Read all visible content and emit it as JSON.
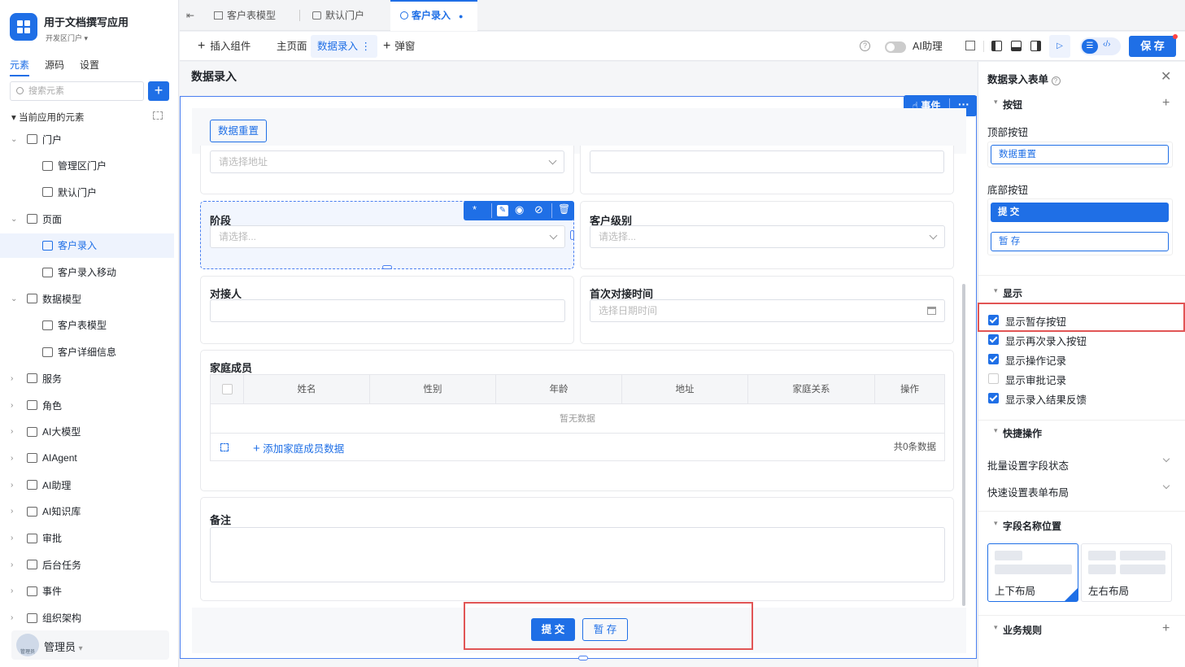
{
  "app": {
    "title": "用于文档撰写应用",
    "subtitle": "开发区门户"
  },
  "sidebar": {
    "tabs": [
      "元素",
      "源码",
      "设置"
    ],
    "search_placeholder": "搜索元素",
    "group_title": "当前应用的元素",
    "items": [
      {
        "label": "门户",
        "level": 1,
        "expanded": true
      },
      {
        "label": "管理区门户",
        "level": 2
      },
      {
        "label": "默认门户",
        "level": 2
      },
      {
        "label": "页面",
        "level": 1,
        "expanded": true
      },
      {
        "label": "客户录入",
        "level": 2,
        "active": true
      },
      {
        "label": "客户录入移动",
        "level": 2
      },
      {
        "label": "数据模型",
        "level": 1,
        "expanded": true
      },
      {
        "label": "客户表模型",
        "level": 2
      },
      {
        "label": "客户详细信息",
        "level": 2
      },
      {
        "label": "服务",
        "level": 1
      },
      {
        "label": "角色",
        "level": 1
      },
      {
        "label": "AI大模型",
        "level": 1
      },
      {
        "label": "AIAgent",
        "level": 1
      },
      {
        "label": "AI助理",
        "level": 1
      },
      {
        "label": "AI知识库",
        "level": 1
      },
      {
        "label": "审批",
        "level": 1
      },
      {
        "label": "后台任务",
        "level": 1
      },
      {
        "label": "事件",
        "level": 1
      },
      {
        "label": "组织架构",
        "level": 1
      }
    ],
    "user": {
      "name": "管理员",
      "avatar_text": "管理员"
    }
  },
  "tabs": [
    {
      "label": "客户表模型"
    },
    {
      "label": "默认门户"
    },
    {
      "label": "客户录入",
      "active": true
    }
  ],
  "toolbar": {
    "insert": "插入组件",
    "main_page": "主页面",
    "data_entry": "数据录入",
    "popup": "弹窗",
    "ai_assistant": "AI助理",
    "save": "保 存"
  },
  "form": {
    "title": "数据录入",
    "event_btn": "事件",
    "reset_btn": "数据重置",
    "address_placeholder": "请选择地址",
    "stage_label": "阶段",
    "stage_placeholder": "请选择...",
    "level_label": "客户级别",
    "level_placeholder": "请选择...",
    "contact_label": "对接人",
    "first_contact_label": "首次对接时间",
    "date_placeholder": "选择日期时间",
    "family_label": "家庭成员",
    "table_headers": [
      "姓名",
      "性别",
      "年龄",
      "地址",
      "家庭关系",
      "操作"
    ],
    "empty_text": "暂无数据",
    "add_row": "添加家庭成员数据",
    "total": "共0条数据",
    "remark_label": "备注",
    "submit": "提 交",
    "draft": "暂 存"
  },
  "panel": {
    "title": "数据录入表单",
    "buttons_section": "按钮",
    "top_buttons": "顶部按钮",
    "top_button_item": "数据重置",
    "bottom_buttons": "底部按钮",
    "bottom_submit": "提 交",
    "bottom_draft": "暂 存",
    "display_section": "显示",
    "options": [
      {
        "label": "显示暂存按钮",
        "checked": true
      },
      {
        "label": "显示再次录入按钮",
        "checked": true
      },
      {
        "label": "显示操作记录",
        "checked": true
      },
      {
        "label": "显示审批记录",
        "checked": false
      },
      {
        "label": "显示录入结果反馈",
        "checked": true
      }
    ],
    "quick_section": "快捷操作",
    "batch_status": "批量设置字段状态",
    "quick_layout": "快速设置表单布局",
    "label_pos_section": "字段名称位置",
    "layout_top": "上下布局",
    "layout_lr": "左右布局",
    "rules_section": "业务规则"
  },
  "colors": {
    "accent": "#1f6fe6",
    "highlight": "#e15555"
  }
}
